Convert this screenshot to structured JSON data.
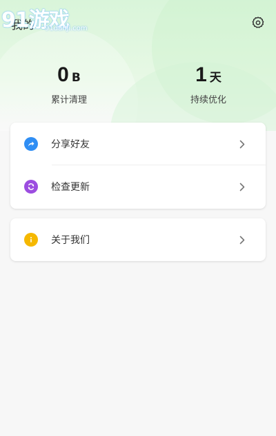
{
  "watermark": {
    "logo_text": "91游戏",
    "site": "91danji.com"
  },
  "header": {
    "title": "我的",
    "settings_icon": "gear-icon"
  },
  "stats": {
    "cleaned": {
      "value": "0",
      "unit": "B",
      "label": "累计清理"
    },
    "optimized": {
      "value": "1",
      "unit": "天",
      "label": "持续优化"
    }
  },
  "menu": {
    "share": {
      "label": "分享好友",
      "icon": "share-icon",
      "color": "#2f8ef4"
    },
    "update": {
      "label": "检查更新",
      "icon": "refresh-icon",
      "color": "#9c4de0"
    },
    "about": {
      "label": "关于我们",
      "icon": "info-icon",
      "color": "#f5b800"
    }
  }
}
